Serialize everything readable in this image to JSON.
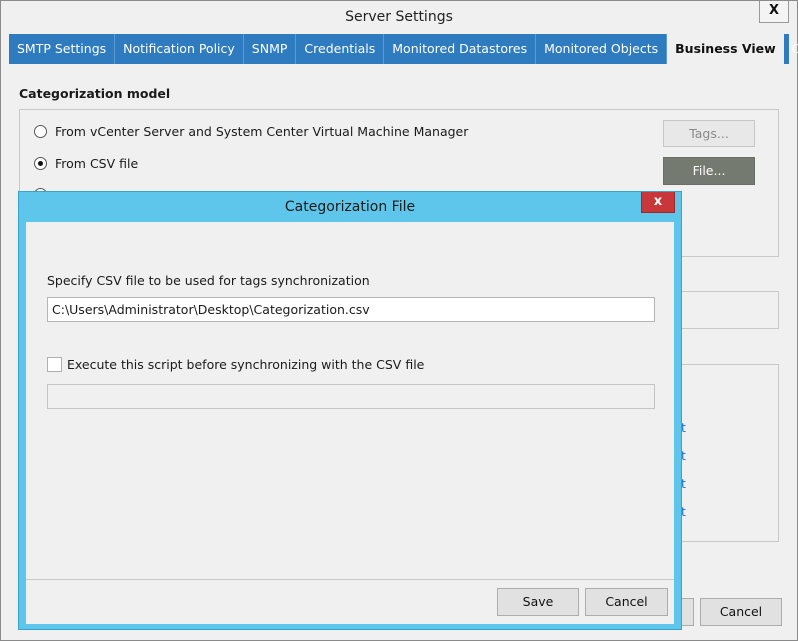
{
  "window": {
    "title": "Server Settings",
    "close_glyph": "X"
  },
  "tabs": [
    "SMTP Settings",
    "Notification Policy",
    "SNMP",
    "Credentials",
    "Monitored Datastores",
    "Monitored Objects",
    "Business View",
    "Other"
  ],
  "active_tab": "Business View",
  "settings": {
    "section_title": "Categorization model",
    "radio_vcenter": "From vCenter Server and System Center Virtual Machine Manager",
    "radio_csv": "From CSV file",
    "tags_button": "Tags...",
    "file_button": "File...",
    "link_fragment": "t",
    "cancel_button": "Cancel"
  },
  "dialog": {
    "title": "Categorization File",
    "close_glyph": "x",
    "csv_label": "Specify CSV file to be used for tags synchronization",
    "csv_path": "C:\\Users\\Administrator\\Desktop\\Categorization.csv",
    "script_checkbox_label": "Execute this script before synchronizing with the CSV file",
    "script_path": "",
    "save_button": "Save",
    "cancel_button": "Cancel"
  },
  "colors": {
    "tab_bar": "#2f7bbf",
    "dialog_frame": "#5ec6ea",
    "dialog_close": "#c8383a",
    "file_button": "#757a70"
  }
}
